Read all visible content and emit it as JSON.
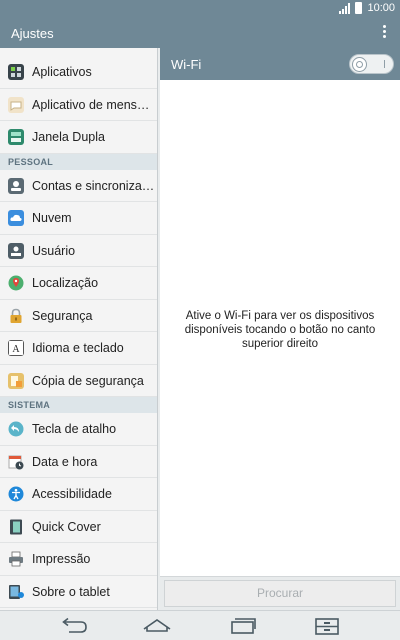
{
  "status_bar": {
    "time": "10:00"
  },
  "app_bar": {
    "title": "Ajustes"
  },
  "sidebar": {
    "items": [
      {
        "label": "Aplicativos",
        "icon": "apps-icon"
      },
      {
        "label": "Aplicativo de mensagens",
        "icon": "messaging-app-icon"
      },
      {
        "label": "Janela Dupla",
        "icon": "dual-window-icon"
      }
    ],
    "section_pessoal": "PESSOAL",
    "pessoal_items": [
      {
        "label": "Contas e sincronização",
        "icon": "accounts-sync-icon"
      },
      {
        "label": "Nuvem",
        "icon": "cloud-icon"
      },
      {
        "label": "Usuário",
        "icon": "user-icon"
      },
      {
        "label": "Localização",
        "icon": "location-icon"
      },
      {
        "label": "Segurança",
        "icon": "lock-icon"
      },
      {
        "label": "Idioma e teclado",
        "icon": "language-keyboard-icon"
      },
      {
        "label": "Cópia de segurança",
        "icon": "backup-icon"
      }
    ],
    "section_sistema": "SISTEMA",
    "sistema_items": [
      {
        "label": "Tecla de atalho",
        "icon": "shortcut-key-icon"
      },
      {
        "label": "Data e hora",
        "icon": "calendar-clock-icon"
      },
      {
        "label": "Acessibilidade",
        "icon": "accessibility-icon"
      },
      {
        "label": "Quick Cover",
        "icon": "quick-cover-icon"
      },
      {
        "label": "Impressão",
        "icon": "printer-icon"
      },
      {
        "label": "Sobre o tablet",
        "icon": "tablet-info-icon"
      }
    ]
  },
  "detail": {
    "title": "Wi-Fi",
    "toggle_state": "off",
    "message": "Ative o Wi-Fi para ver os dispositivos disponíveis tocando o botão no canto superior direito",
    "search_button": "Procurar"
  },
  "nav_bar": {
    "buttons": [
      "back-icon",
      "home-icon",
      "recent-apps-icon",
      "dual-window-nav-icon"
    ]
  },
  "colors": {
    "bar": "#6f8896",
    "section_bg": "#dde5e9",
    "section_text": "#5e7380"
  }
}
